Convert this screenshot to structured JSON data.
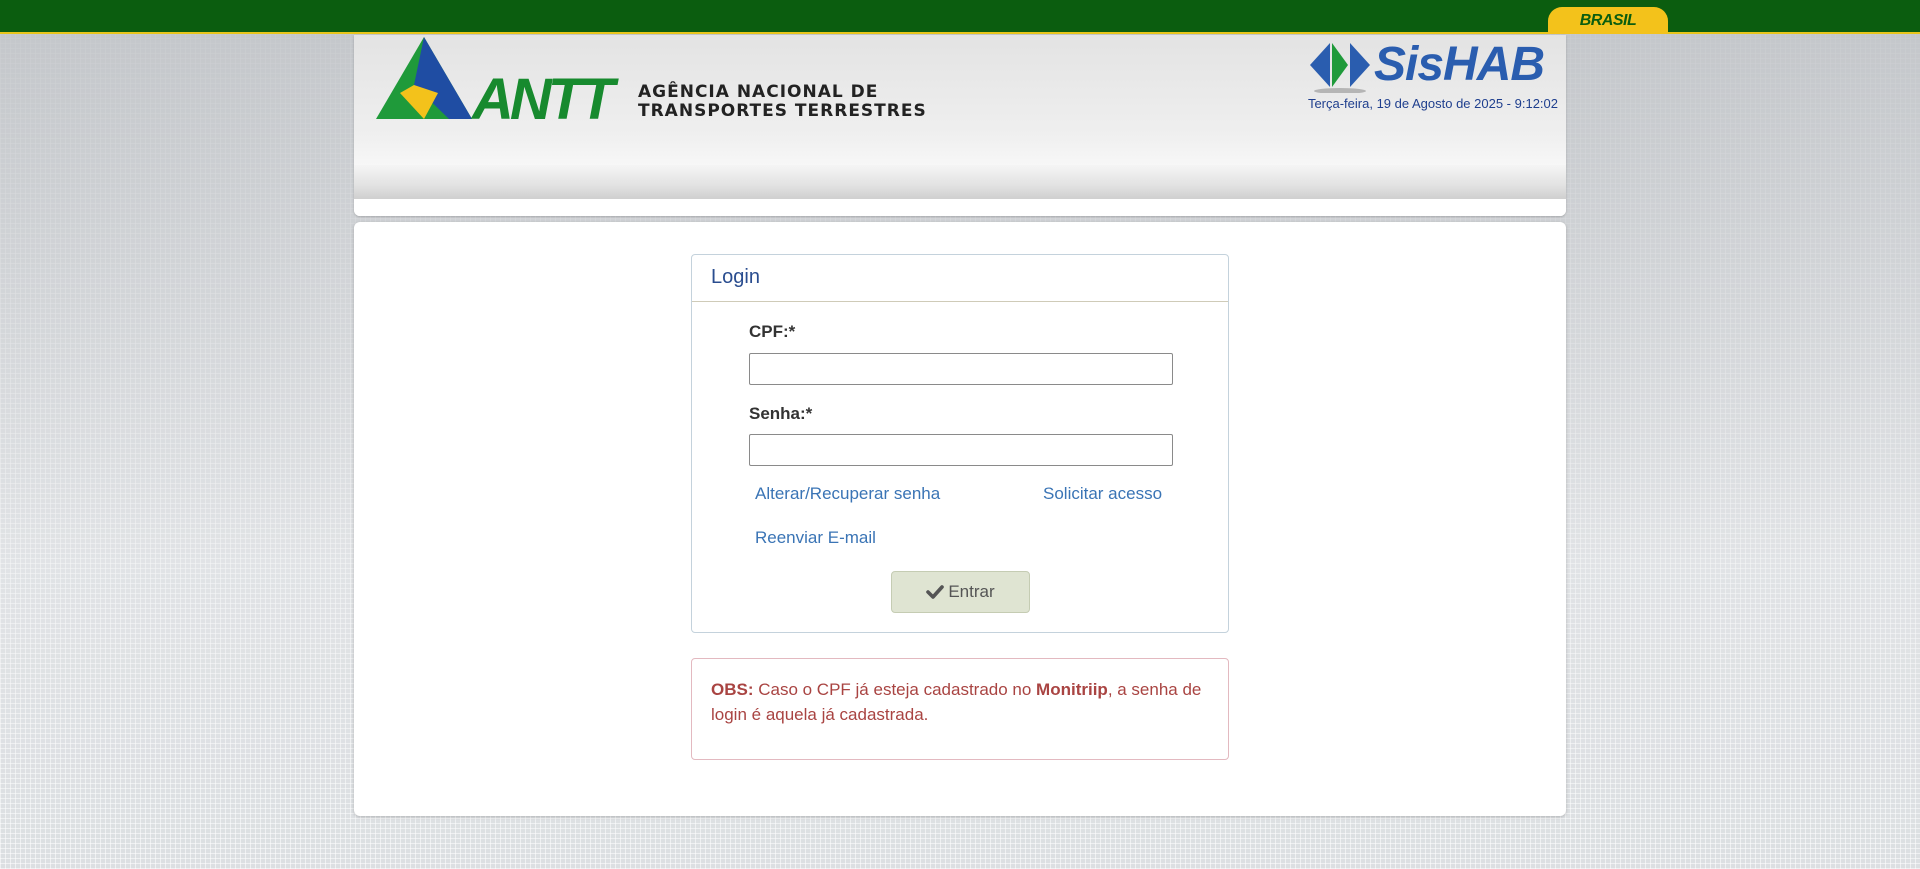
{
  "gov_bar": {
    "badge": "BRASIL"
  },
  "header": {
    "agency_line1": "AGÊNCIA NACIONAL DE",
    "agency_line2": "TRANSPORTES TERRESTRES",
    "logo_text": "ANTT",
    "system_name": "SisHAB",
    "datetime": "Terça-feira, 19 de Agosto de 2025 - 9:12:02"
  },
  "login": {
    "title": "Login",
    "cpf_label": "CPF:*",
    "cpf_value": "",
    "password_label": "Senha:*",
    "password_value": "",
    "change_password_link": "Alterar/Recuperar senha",
    "request_access_link": "Solicitar acesso",
    "resend_email_link": "Reenviar E-mail",
    "enter_button": "Entrar"
  },
  "obs": {
    "prefix": "OBS:",
    "text1": " Caso o CPF já esteja cadastrado no ",
    "highlight": "Monitriip",
    "text2": ", a senha de login é aquela já cadastrada."
  },
  "colors": {
    "gov_green": "#0b5d0f",
    "gov_yellow": "#f3c21b",
    "link_blue": "#3a74b5",
    "title_blue": "#2a4d8f",
    "alert_red": "#a94442"
  }
}
